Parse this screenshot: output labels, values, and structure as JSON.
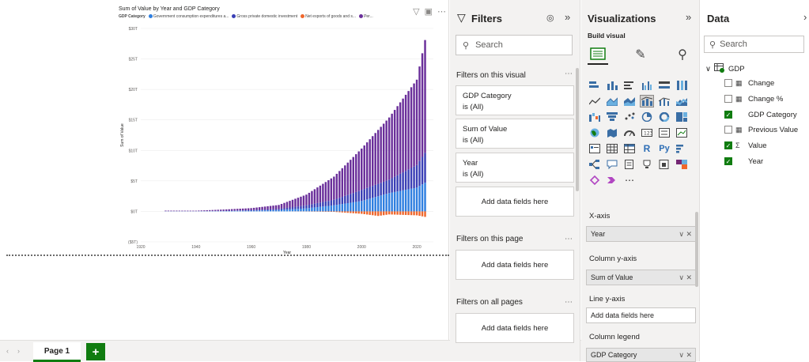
{
  "canvas": {
    "visual_title": "Sum of Value by Year and GDP Category",
    "legend_label": "GDP Category",
    "legend_items": [
      {
        "name": "Government consumption expenditures a...",
        "color": "#2f7fe0"
      },
      {
        "name": "Gross private domestic investment",
        "color": "#3a3fb5"
      },
      {
        "name": "Net exports of goods and s...",
        "color": "#f0672c"
      },
      {
        "name": "Per...",
        "color": "#6a2f9a"
      }
    ]
  },
  "chart_data": {
    "type": "bar",
    "title": "Sum of Value by Year and GDP Category",
    "xlabel": "Year",
    "ylabel": "Sum of Value",
    "x_ticks": [
      "1920",
      "1940",
      "1960",
      "1980",
      "2000",
      "2020"
    ],
    "y_ticks": [
      "($5T)",
      "$0T",
      "$5T",
      "$10T",
      "$15T",
      "$20T",
      "$25T",
      "$30T"
    ],
    "ylim": [
      -5,
      30
    ],
    "xlim": [
      1920,
      2026
    ],
    "series_colors": [
      "#2f7fe0",
      "#3a3fb5",
      "#6a2f9a",
      "#f0672c"
    ],
    "series": [
      {
        "name": "Government consumption expenditures a...",
        "values_at": [
          [
            1929,
            0.02
          ],
          [
            1940,
            0.02
          ],
          [
            1950,
            0.05
          ],
          [
            1960,
            0.12
          ],
          [
            1970,
            0.22
          ],
          [
            1980,
            0.5
          ],
          [
            1990,
            1.0
          ],
          [
            2000,
            1.7
          ],
          [
            2010,
            3.0
          ],
          [
            2020,
            3.9
          ],
          [
            2023,
            4.7
          ]
        ]
      },
      {
        "name": "Gross private domestic investment",
        "values_at": [
          [
            1929,
            0.02
          ],
          [
            1940,
            0.02
          ],
          [
            1950,
            0.05
          ],
          [
            1960,
            0.08
          ],
          [
            1970,
            0.18
          ],
          [
            1980,
            0.5
          ],
          [
            1990,
            0.9
          ],
          [
            2000,
            1.8
          ],
          [
            2010,
            2.2
          ],
          [
            2020,
            3.7
          ],
          [
            2023,
            4.9
          ]
        ]
      },
      {
        "name": "Per...",
        "values_at": [
          [
            1929,
            0.08
          ],
          [
            1940,
            0.07
          ],
          [
            1950,
            0.2
          ],
          [
            1960,
            0.33
          ],
          [
            1970,
            0.65
          ],
          [
            1980,
            1.75
          ],
          [
            1990,
            3.8
          ],
          [
            2000,
            6.8
          ],
          [
            2010,
            10.2
          ],
          [
            2020,
            14.0
          ],
          [
            2023,
            18.5
          ]
        ]
      },
      {
        "name": "Net exports of goods and s...",
        "values_at": [
          [
            1929,
            0.0
          ],
          [
            1960,
            0.0
          ],
          [
            1970,
            0.0
          ],
          [
            1980,
            -0.02
          ],
          [
            1990,
            -0.08
          ],
          [
            2000,
            -0.4
          ],
          [
            2006,
            -0.75
          ],
          [
            2010,
            -0.5
          ],
          [
            2020,
            -0.65
          ],
          [
            2023,
            -0.9
          ]
        ]
      }
    ]
  },
  "tabs": {
    "page_1": "Page 1",
    "add": "+",
    "prev": "‹",
    "next": "›"
  },
  "filters": {
    "title": "Filters",
    "search_placeholder": "Search",
    "on_visual_label": "Filters on this visual",
    "cards": [
      {
        "name": "GDP Category",
        "state": "is (All)"
      },
      {
        "name": "Sum of Value",
        "state": "is (All)"
      },
      {
        "name": "Year",
        "state": "is (All)"
      }
    ],
    "add_fields": "Add data fields here",
    "on_page_label": "Filters on this page",
    "on_all_pages_label": "Filters on all pages"
  },
  "viz": {
    "title": "Visualizations",
    "build_label": "Build visual",
    "wells": {
      "xaxis_label": "X-axis",
      "xaxis_value": "Year",
      "col_y_label": "Column y-axis",
      "col_y_value": "Sum of Value",
      "line_y_label": "Line y-axis",
      "line_y_placeholder": "Add data fields here",
      "legend_label": "Column legend",
      "legend_value": "GDP Category"
    }
  },
  "data": {
    "title": "Data",
    "search_placeholder": "Search",
    "table_name": "GDP",
    "fields": [
      {
        "name": "Change",
        "checked": false,
        "icon": "calc-icon"
      },
      {
        "name": "Change %",
        "checked": false,
        "icon": "calc-icon"
      },
      {
        "name": "GDP Category",
        "checked": true,
        "icon": ""
      },
      {
        "name": "Previous Value",
        "checked": false,
        "icon": "calc-icon"
      },
      {
        "name": "Value",
        "checked": true,
        "icon": "sigma"
      },
      {
        "name": "Year",
        "checked": true,
        "icon": ""
      }
    ]
  }
}
